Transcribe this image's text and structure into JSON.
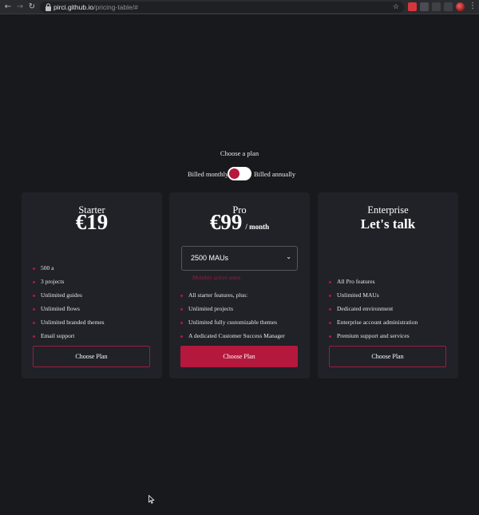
{
  "browser": {
    "url_host": "pirci.github.io",
    "url_path": "/pricing-table/#"
  },
  "colors": {
    "background": "#18191d",
    "card": "#202228",
    "accent": "#b5183d",
    "hint": "#9c1c3e"
  },
  "header": {
    "title": "Choose a plan",
    "billing_monthly": "Billed monthly",
    "billing_annually": "Billed annually",
    "toggle_state": "monthly"
  },
  "plans": [
    {
      "name": "Starter",
      "price": "€19",
      "features": [
        "500 a",
        "3 projects",
        "Unlimited guides",
        "Unlimited flows",
        "Unlimited branded themes",
        "Email support"
      ],
      "cta": "Choose Plan"
    },
    {
      "name": "Pro",
      "price": "€99",
      "period": "/ month",
      "select_value": "2500 MAUs",
      "select_hint": "Monthly active users",
      "features": [
        "All starter features, plus:",
        "Unlimited projects",
        "Unlimited fully customizable themes",
        "A dedicated Customer Success Manager"
      ],
      "cta": "Choose Plan"
    },
    {
      "name": "Enterprise",
      "price": "Let's talk",
      "features": [
        "All Pro features",
        "Unlimited MAUs",
        "Dedicated environment",
        "Enterprise account administration",
        "Premium support and services"
      ],
      "cta": "Choose Plan"
    }
  ]
}
